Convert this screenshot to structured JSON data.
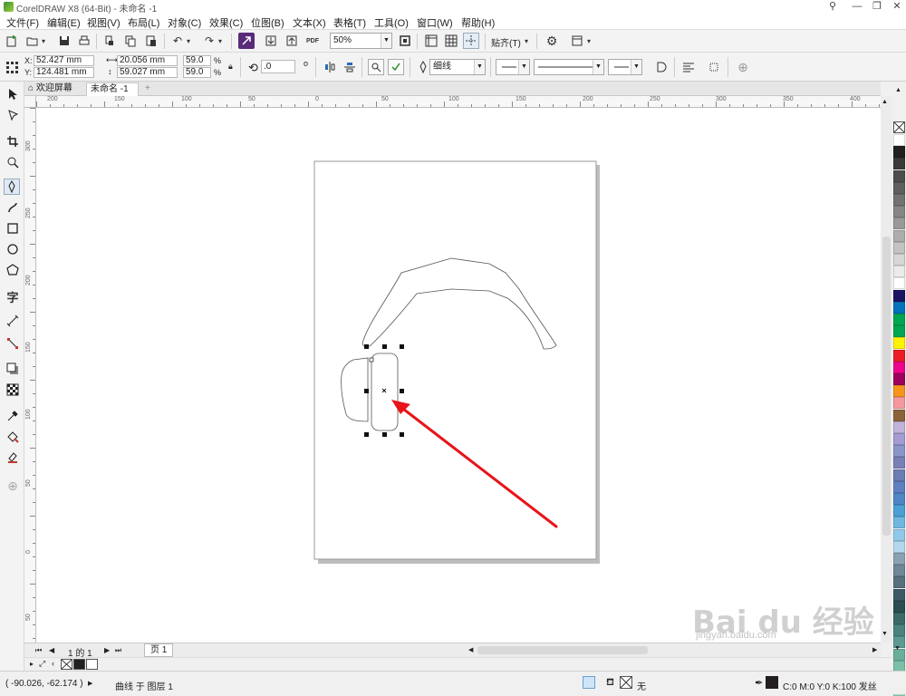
{
  "window": {
    "title": "CorelDRAW X8 (64-Bit) - 未命名 -1"
  },
  "menu": [
    "文件(F)",
    "编辑(E)",
    "视图(V)",
    "布局(L)",
    "对象(C)",
    "效果(C)",
    "位图(B)",
    "文本(X)",
    "表格(T)",
    "工具(O)",
    "窗口(W)",
    "帮助(H)"
  ],
  "toolbar": {
    "zoom": "50%",
    "snap_label": "贴齐(T)",
    "pdf_label": "PDF"
  },
  "propbar": {
    "x_label": "X:",
    "x": "52.427 mm",
    "y_label": "Y:",
    "y": "124.481 mm",
    "w": "20.056 mm",
    "h": "59.027 mm",
    "sx": "59.0",
    "sy": "59.0",
    "pct": "%",
    "rotation": ".0",
    "deg": "o",
    "outline_width": "细线"
  },
  "tabs": {
    "welcome": "欢迎屏幕",
    "doc": "未命名 -1"
  },
  "ruler_h": [
    "200",
    "150",
    "100",
    "50",
    "0",
    "50",
    "100",
    "150",
    "200",
    "250",
    "300",
    "350",
    "400"
  ],
  "ruler_v": [
    "300",
    "250",
    "200",
    "150",
    "100",
    "50",
    "0",
    "50"
  ],
  "pagenav": {
    "page_of": "1 的 1",
    "page_tab": "页 1"
  },
  "status": {
    "coords": "( -90.026, -62.174 )",
    "object_info": "曲线 于 图层 1",
    "fill_none": "无",
    "outline_info": "C:0 M:0 Y:0 K:100 发丝"
  },
  "palette": [
    "#ffffff",
    "#231f20",
    "#3a3a3a",
    "#4d4d4d",
    "#5f5f5f",
    "#727272",
    "#858585",
    "#999999",
    "#adadad",
    "#c2c2c2",
    "#d6d6d6",
    "#ebebeb",
    "#ffffff",
    "#1b1464",
    "#0072bc",
    "#00a651",
    "#00a651",
    "#fff200",
    "#ed1c24",
    "#ec008c",
    "#9e005d",
    "#f7941d",
    "#f6989d",
    "#8c6239",
    "#bfb3d9",
    "#a39bd2",
    "#8c95c8",
    "#7b7fb8",
    "#6a7cb3",
    "#5e7fc0",
    "#4f86c6",
    "#4b9fd5",
    "#6fb7e0",
    "#8fc8e8",
    "#b3d8ee",
    "#8aa0b3",
    "#6f8797",
    "#56707e",
    "#3e5966",
    "#2a4d52",
    "#3a6a6a",
    "#4a8380",
    "#5a9a90",
    "#6aae9c",
    "#7cbfa8",
    "#8ecfb4",
    "#9fdcc1"
  ],
  "watermark": {
    "logo": "Bai du 经验",
    "url": "jingyan.baidu.com"
  }
}
